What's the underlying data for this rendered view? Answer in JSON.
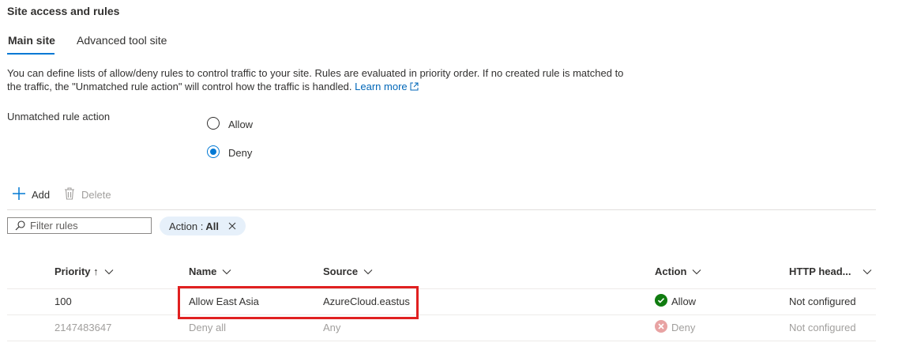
{
  "section": {
    "title": "Site access and rules"
  },
  "tabs": [
    {
      "label": "Main site",
      "selected": true
    },
    {
      "label": "Advanced tool site",
      "selected": false
    }
  ],
  "description": {
    "text": "You can define lists of allow/deny rules to control traffic to your site. Rules are evaluated in priority order. If no created rule is matched to the traffic, the \"Unmatched rule action\" will control how the traffic is handled.",
    "link": "Learn more"
  },
  "unmatched_rule_action": {
    "label": "Unmatched rule action",
    "options": [
      {
        "label": "Allow",
        "selected": false
      },
      {
        "label": "Deny",
        "selected": true
      }
    ]
  },
  "toolbar": {
    "add_label": "Add",
    "delete_label": "Delete"
  },
  "filter": {
    "placeholder": "Filter rules",
    "pill_prefix": "Action :",
    "pill_value": "All"
  },
  "table": {
    "headers": {
      "priority": "Priority ↑",
      "name": "Name",
      "source": "Source",
      "action": "Action",
      "http": "HTTP head..."
    },
    "rows": [
      {
        "priority": "100",
        "name": "Allow East Asia",
        "source": "AzureCloud.eastus",
        "action": "Allow",
        "http": "Not configured"
      },
      {
        "priority": "2147483647",
        "name": "Deny all",
        "source": "Any",
        "action": "Deny",
        "http": "Not configured"
      }
    ]
  },
  "colors": {
    "accent": "#0078d4",
    "allow": "#107c10",
    "deny": "#e8a3a3",
    "highlight": "#e02020",
    "pill": "#e6f0fa"
  }
}
